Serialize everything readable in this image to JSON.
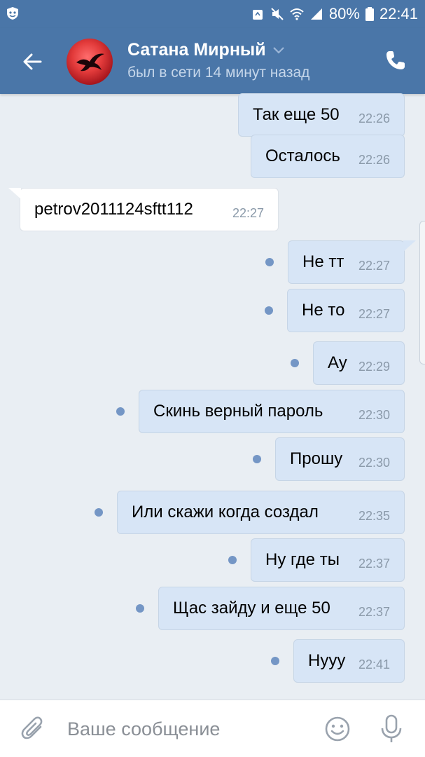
{
  "status_bar": {
    "battery": "80%",
    "time": "22:41",
    "icons": [
      "vk-shield-icon",
      "recycle-icon",
      "mute-icon",
      "wifi-icon",
      "signal-icon",
      "battery-icon"
    ]
  },
  "header": {
    "contact_name": "Сатана Мирный",
    "contact_status": "был в сети 14 минут назад",
    "colors": {
      "bar": "#4a76a8",
      "status_text": "#c5d6ea"
    }
  },
  "messages": [
    {
      "direction": "out",
      "text": "Так еще 50",
      "time": "22:26",
      "unread": false
    },
    {
      "direction": "out",
      "text": "Осталось",
      "time": "22:26",
      "unread": false
    },
    {
      "direction": "in",
      "text": "petrov2011124sftt112",
      "time": "22:27",
      "unread": false
    },
    {
      "direction": "out",
      "text": "Не тт",
      "time": "22:27",
      "unread": true
    },
    {
      "direction": "out",
      "text": "Не то",
      "time": "22:27",
      "unread": true
    },
    {
      "direction": "out",
      "text": "Ау",
      "time": "22:29",
      "unread": true
    },
    {
      "direction": "out",
      "text": "Скинь верный пароль",
      "time": "22:30",
      "unread": true
    },
    {
      "direction": "out",
      "text": "Прошу",
      "time": "22:30",
      "unread": true
    },
    {
      "direction": "out",
      "text": "Или скажи когда создал",
      "time": "22:35",
      "unread": true
    },
    {
      "direction": "out",
      "text": "Ну где ты",
      "time": "22:37",
      "unread": true
    },
    {
      "direction": "out",
      "text": "Щас зайду и еще 50",
      "time": "22:37",
      "unread": true
    },
    {
      "direction": "out",
      "text": "Нууу",
      "time": "22:41",
      "unread": true
    }
  ],
  "composer": {
    "placeholder": "Ваше сообщение",
    "value": ""
  },
  "colors": {
    "background": "#e9eef3",
    "outgoing_bubble": "#d7e5f6",
    "incoming_bubble": "#ffffff",
    "unread_dot": "#7496c5",
    "time_text": "#8a99a9"
  }
}
